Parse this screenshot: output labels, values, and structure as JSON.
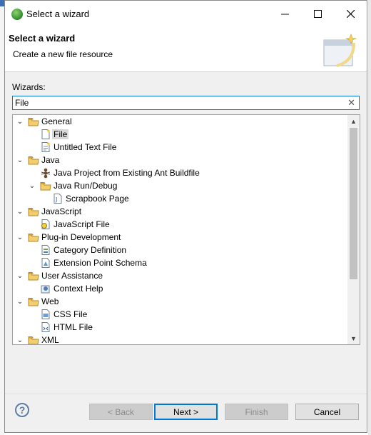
{
  "window": {
    "title": "Select a wizard"
  },
  "header": {
    "title": "Select a wizard",
    "subtitle": "Create a new file resource"
  },
  "wizards_label": "Wizards:",
  "filter": {
    "value": "File",
    "placeholder": ""
  },
  "tree": [
    {
      "label": "General",
      "type": "folder",
      "expanded": true,
      "level": 0
    },
    {
      "label": "File",
      "type": "file-new",
      "level": 1,
      "selected": true
    },
    {
      "label": "Untitled Text File",
      "type": "text-file",
      "level": 1
    },
    {
      "label": "Java",
      "type": "folder",
      "expanded": true,
      "level": 0
    },
    {
      "label": "Java Project from Existing Ant Buildfile",
      "type": "ant",
      "level": 1
    },
    {
      "label": "Java Run/Debug",
      "type": "folder",
      "expanded": true,
      "level": 1
    },
    {
      "label": "Scrapbook Page",
      "type": "scrapbook",
      "level": 2
    },
    {
      "label": "JavaScript",
      "type": "folder",
      "expanded": true,
      "level": 0
    },
    {
      "label": "JavaScript File",
      "type": "js-file",
      "level": 1
    },
    {
      "label": "Plug-in Development",
      "type": "folder",
      "expanded": true,
      "level": 0
    },
    {
      "label": "Category Definition",
      "type": "category",
      "level": 1
    },
    {
      "label": "Extension Point Schema",
      "type": "schema",
      "level": 1
    },
    {
      "label": "User Assistance",
      "type": "folder",
      "expanded": true,
      "level": 0
    },
    {
      "label": "Context Help",
      "type": "context-help",
      "level": 1
    },
    {
      "label": "Web",
      "type": "folder",
      "expanded": true,
      "level": 0
    },
    {
      "label": "CSS File",
      "type": "css-file",
      "level": 1
    },
    {
      "label": "HTML File",
      "type": "html-file",
      "level": 1
    },
    {
      "label": "XML",
      "type": "folder",
      "expanded": true,
      "level": 0
    }
  ],
  "buttons": {
    "back": "< Back",
    "next": "Next >",
    "finish": "Finish",
    "cancel": "Cancel"
  },
  "colors": {
    "accent": "#0078d7",
    "folder": "#e8b84a",
    "selection": "#d9d9d9"
  }
}
